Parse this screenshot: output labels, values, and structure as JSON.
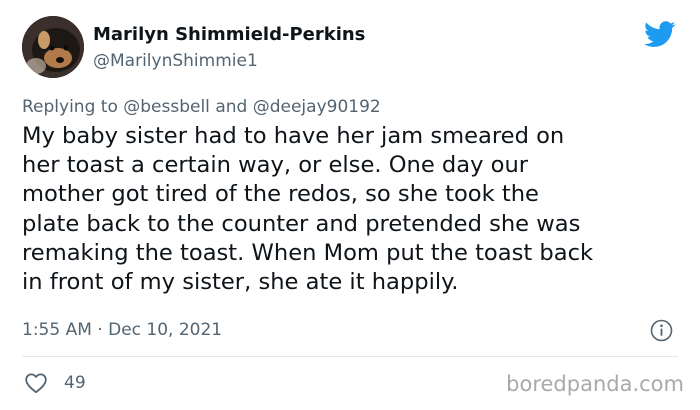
{
  "author": {
    "name": "Marilyn Shimmield-Perkins",
    "handle": "@MarilynShimmie1"
  },
  "reply": {
    "prefix": "Replying to",
    "mention_1": "@bessbell",
    "conjunction": "and",
    "mention_2": "@deejay90192"
  },
  "tweet": {
    "text": "My baby sister had to have her jam smeared on\nher toast a certain way, or else.  One day our\nmother got tired of the redos, so she took the\nplate back to the counter and pretended she was\nremaking the toast.  When Mom put the toast back\nin front of my sister, she ate it happily.",
    "time": "1:55 AM",
    "separator": "·",
    "date": "Dec 10, 2021"
  },
  "actions": {
    "like_icon": "heart-outline-icon",
    "like_count": "49",
    "info_icon": "info-icon"
  },
  "brand": {
    "logo_icon": "twitter-bird-icon",
    "accent_color": "#1d9bf0",
    "watermark": "boredpanda.com"
  }
}
